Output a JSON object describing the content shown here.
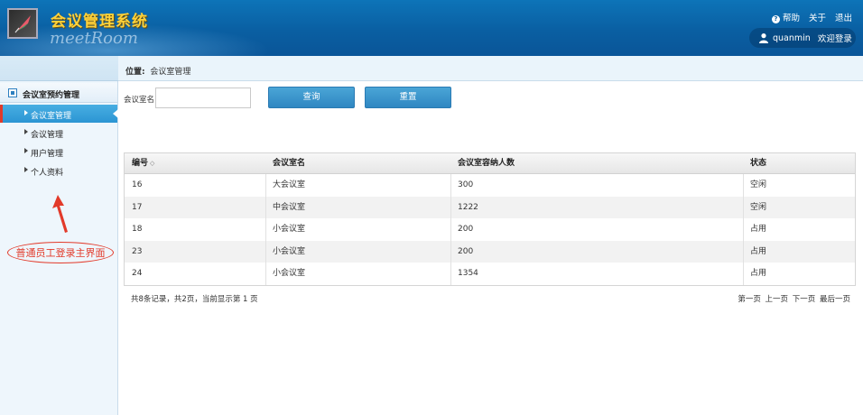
{
  "header": {
    "title": "会议管理系统",
    "subtitle": "meetRoom",
    "links": {
      "help": "帮助",
      "about": "关于",
      "logout": "退出"
    },
    "user": {
      "name": "quanmin",
      "welcome": "欢迎登录"
    }
  },
  "location": {
    "label": "位置:",
    "value": "会议室管理"
  },
  "sidebar": {
    "section": "会议室预约管理",
    "items": [
      {
        "label": "会议室管理",
        "active": true
      },
      {
        "label": "会议管理"
      },
      {
        "label": "用户管理"
      },
      {
        "label": "个人资料"
      }
    ],
    "annotation": "普通员工登录主界面"
  },
  "search": {
    "label": "会议室名:",
    "value": "",
    "placeholder": "",
    "query_button": "查询",
    "reset_button": "重置"
  },
  "table": {
    "columns": [
      "编号",
      "会议室名",
      "会议室容纳人数",
      "状态"
    ],
    "sort_icon": "◇",
    "rows": [
      [
        "16",
        "大会议室",
        "300",
        "空闲"
      ],
      [
        "17",
        "中会议室",
        "1222",
        "空闲"
      ],
      [
        "18",
        "小会议室",
        "200",
        "占用"
      ],
      [
        "23",
        "小会议室",
        "200",
        "占用"
      ],
      [
        "24",
        "小会议室",
        "1354",
        "占用"
      ]
    ]
  },
  "pagination": {
    "summary": "共8条记录，共2页，当前显示第 1 页",
    "first": "第一页",
    "prev": "上一页",
    "next": "下一页",
    "last": "最后一页"
  },
  "colors": {
    "header_blue": "#0a5fa2",
    "title_gold": "#ffd23a",
    "active_blue": "#2b95d3",
    "annotation_red": "#e23a2a"
  }
}
